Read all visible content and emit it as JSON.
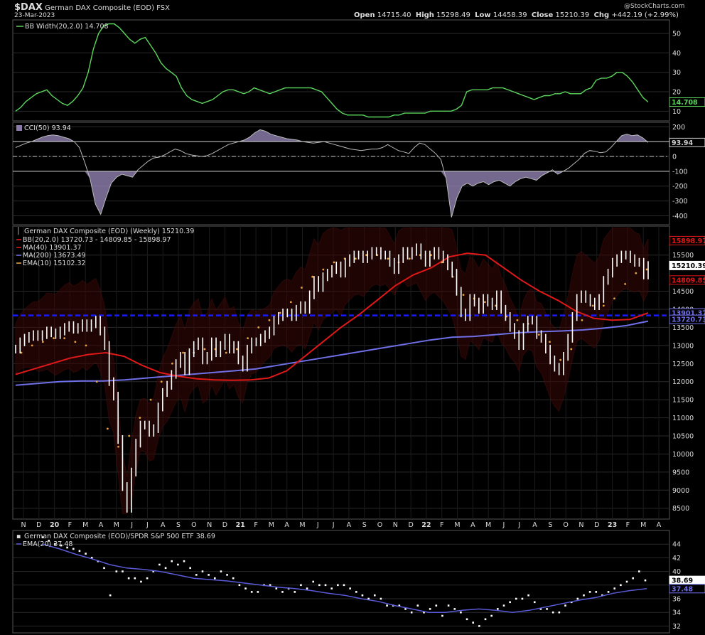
{
  "header": {
    "symbol": "$DAX",
    "name": "German DAX Composite (EOD)",
    "exchange": "FSX",
    "date": "23-Mar-2023",
    "watermark": "@StockCharts.com",
    "ohlc": {
      "open_label": "Open",
      "open": "14715.40",
      "high_label": "High",
      "high": "15298.49",
      "low_label": "Low",
      "low": "14458.39",
      "close_label": "Close",
      "close": "15210.39",
      "chg_label": "Chg",
      "chg": "+442.19 (+2.99%)"
    }
  },
  "colors": {
    "background": "#000000",
    "grid": "#2a2a2a",
    "bbwidth": "#5cd65c",
    "cci_fill": "#8a7aa8",
    "cci_line": "#bbbbbb",
    "price": "#ffffff",
    "ma40": "#e01818",
    "ma200": "#6f6fe8",
    "ema10": "#e8a040",
    "bb_fill": "#3a0808",
    "support": "#1a1aff",
    "ratio": "#ffffff",
    "ratio_ema": "#5a5ad8"
  },
  "chart_data": [
    {
      "type": "line",
      "panel": "bb_width",
      "legend": "BB Width(20,2.0) 14.708",
      "last_value": "14.708",
      "ylim": [
        5,
        57
      ],
      "yticks": [
        "50",
        "40",
        "30",
        "20",
        "10"
      ],
      "ytick_values": [
        50,
        40,
        30,
        20,
        10
      ],
      "series": [
        {
          "name": "BB Width(20,2.0)",
          "values": [
            10,
            12,
            15,
            17,
            19,
            20,
            21,
            18,
            16,
            14,
            13,
            15,
            18,
            22,
            30,
            42,
            50,
            54,
            55,
            55,
            53,
            50,
            47,
            45,
            47,
            48,
            44,
            40,
            35,
            32,
            30,
            28,
            22,
            18,
            16,
            15,
            14,
            15,
            16,
            18,
            20,
            21,
            21,
            20,
            19,
            20,
            22,
            21,
            20,
            19,
            20,
            21,
            22,
            22,
            22,
            22,
            22,
            22,
            21,
            20,
            17,
            14,
            11,
            9,
            8,
            8,
            8,
            8,
            7,
            7,
            7,
            7,
            7,
            8,
            8,
            9,
            9,
            9,
            9,
            9,
            10,
            10,
            10,
            10,
            10,
            11,
            13,
            20,
            21,
            21,
            21,
            21,
            22,
            22,
            22,
            21,
            20,
            19,
            18,
            17,
            16,
            17,
            18,
            18,
            19,
            19,
            20,
            19,
            19,
            19,
            21,
            22,
            26,
            27,
            27,
            28,
            30,
            30,
            28,
            25,
            21,
            17,
            14.708
          ]
        }
      ]
    },
    {
      "type": "area",
      "panel": "cci",
      "legend": "CCI(50) 93.94",
      "last_value": "93.94",
      "ylim": [
        -460,
        230
      ],
      "yticks": [
        "200",
        "100",
        "0",
        "-100",
        "-200",
        "-300",
        "-400"
      ],
      "ytick_values": [
        200,
        100,
        0,
        -100,
        -200,
        -300,
        -400
      ],
      "reference_lines": [
        100,
        0,
        -100
      ],
      "series": [
        {
          "name": "CCI(50)",
          "values": [
            60,
            75,
            90,
            100,
            115,
            130,
            140,
            145,
            140,
            130,
            120,
            100,
            60,
            -40,
            -150,
            -320,
            -390,
            -280,
            -180,
            -140,
            -120,
            -130,
            -140,
            -90,
            -60,
            -30,
            -10,
            -5,
            10,
            30,
            50,
            40,
            20,
            10,
            5,
            0,
            5,
            20,
            40,
            60,
            80,
            90,
            100,
            110,
            130,
            160,
            180,
            170,
            150,
            140,
            130,
            120,
            115,
            110,
            100,
            95,
            90,
            95,
            100,
            90,
            80,
            70,
            60,
            50,
            45,
            40,
            45,
            50,
            50,
            60,
            80,
            60,
            40,
            30,
            20,
            60,
            90,
            80,
            50,
            20,
            -20,
            -150,
            -410,
            -280,
            -200,
            -180,
            -200,
            -180,
            -170,
            -190,
            -170,
            -160,
            -180,
            -200,
            -170,
            -150,
            -140,
            -150,
            -160,
            -130,
            -110,
            -90,
            -120,
            -100,
            -80,
            -50,
            -20,
            20,
            40,
            35,
            25,
            30,
            60,
            100,
            140,
            150,
            140,
            145,
            125,
            93.94
          ]
        }
      ]
    },
    {
      "type": "line",
      "panel": "price",
      "legend": "German DAX Composite (EOD) (Weekly) 15210.39",
      "legend_items": [
        {
          "label": "BB(20,2.0) 13720.73 - 14809.85 - 15898.97",
          "color": "#e01818"
        },
        {
          "label": "MA(40) 13901.37",
          "color": "#e01818"
        },
        {
          "label": "MA(200) 13673.49",
          "color": "#6f6fe8"
        },
        {
          "label": "EMA(10) 15102.32",
          "color": "#e8a040"
        }
      ],
      "ylim": [
        8200,
        16300
      ],
      "yticks": [
        "15500",
        "14500",
        "14000",
        "13500",
        "13000",
        "12500",
        "12000",
        "11500",
        "11000",
        "10500",
        "10000",
        "9500",
        "9000",
        "8500"
      ],
      "ytick_values": [
        15500,
        14500,
        14000,
        13500,
        13000,
        12500,
        12000,
        11500,
        11000,
        10500,
        10000,
        9500,
        9000,
        8500
      ],
      "value_tags": [
        {
          "value": 15898.97,
          "text": "15898.97",
          "color": "#e01818"
        },
        {
          "value": 15210.39,
          "text": "15210.39",
          "color": "#ffffff"
        },
        {
          "value": 14809.85,
          "text": "14809.85",
          "color": "#e01818"
        },
        {
          "value": 13901.37,
          "text": "13901.37",
          "color": "#6f6fe8"
        },
        {
          "value": 13720.73,
          "text": "13720.73",
          "color": "#6f6fe8"
        }
      ],
      "support_level": 13830,
      "x": [
        "N",
        "D",
        "20",
        "F",
        "M",
        "A",
        "M",
        "J",
        "J",
        "A",
        "S",
        "O",
        "N",
        "D",
        "21",
        "F",
        "M",
        "A",
        "M",
        "J",
        "J",
        "A",
        "S",
        "O",
        "N",
        "D",
        "22",
        "F",
        "M",
        "A",
        "M",
        "J",
        "J",
        "A",
        "S",
        "O",
        "N",
        "D",
        "23",
        "F",
        "M",
        "A"
      ],
      "series": [
        {
          "name": "German DAX Composite (EOD)",
          "values": [
            12900,
            13100,
            13200,
            13250,
            13300,
            13250,
            13300,
            13400,
            13350,
            13300,
            13400,
            13500,
            13550,
            13450,
            13500,
            13600,
            13500,
            13600,
            13700,
            13400,
            13000,
            12000,
            11600,
            10400,
            9100,
            8500,
            9500,
            10300,
            10800,
            10800,
            10600,
            10700,
            11300,
            11700,
            11900,
            12200,
            12500,
            12700,
            12300,
            12800,
            13000,
            13100,
            12600,
            12700,
            13100,
            12800,
            13000,
            13200,
            12900,
            13000,
            12600,
            12400,
            12900,
            13100,
            13100,
            13200,
            13300,
            13400,
            13700,
            13800,
            13900,
            13900,
            13800,
            14000,
            14100,
            14000,
            14400,
            14800,
            14600,
            14900,
            15000,
            15100,
            15200,
            15000,
            15300,
            15400,
            15500,
            15500,
            15400,
            15500,
            15600,
            15600,
            15500,
            15500,
            15300,
            15100,
            15400,
            15600,
            15500,
            15600,
            15700,
            15500,
            15300,
            15500,
            15600,
            15500,
            15400,
            15200,
            15000,
            14500,
            13900,
            13800,
            14300,
            14200,
            14000,
            14300,
            14200,
            14100,
            14400,
            14000,
            13800,
            13500,
            13300,
            13000,
            13500,
            13700,
            13700,
            13300,
            13200,
            12900,
            12600,
            12400,
            12300,
            12700,
            13200,
            13800,
            14300,
            14400,
            14300,
            14200,
            14100,
            14300,
            14800,
            15000,
            15300,
            15400,
            15500,
            15500,
            15400,
            15300,
            15300,
            14950,
            15210.39
          ]
        },
        {
          "name": "MA(40)",
          "values": [
            12200,
            12350,
            12500,
            12650,
            12750,
            12800,
            12700,
            12450,
            12250,
            12150,
            12080,
            12050,
            12040,
            12050,
            12100,
            12300,
            12700,
            13100,
            13500,
            13850,
            14250,
            14650,
            14950,
            15150,
            15450,
            15550,
            15500,
            15150,
            14800,
            14500,
            14250,
            13950,
            13750,
            13700,
            13720,
            13901.37
          ]
        },
        {
          "name": "MA(200)",
          "values": [
            11900,
            11950,
            12000,
            12020,
            12020,
            12050,
            12100,
            12150,
            12200,
            12250,
            12300,
            12350,
            12450,
            12550,
            12650,
            12750,
            12850,
            12950,
            13050,
            13150,
            13230,
            13250,
            13300,
            13350,
            13380,
            13400,
            13430,
            13480,
            13550,
            13673.49
          ]
        },
        {
          "name": "EMA(10)",
          "values": [
            12800,
            13000,
            13100,
            13200,
            13200,
            13100,
            13000,
            12000,
            10700,
            10200,
            10500,
            11000,
            11500,
            12000,
            12500,
            12800,
            12800,
            12900,
            12900,
            12800,
            12900,
            13200,
            13500,
            13700,
            13900,
            14200,
            14600,
            14900,
            15100,
            15300,
            15400,
            15400,
            15500,
            15500,
            15400,
            15300,
            15400,
            15500,
            15500,
            15300,
            14900,
            14400,
            14300,
            14200,
            14100,
            13800,
            13700,
            13600,
            13300,
            13100,
            12600,
            12900,
            13700,
            14100,
            14100,
            14300,
            14700,
            15000,
            15102.32
          ]
        }
      ]
    },
    {
      "type": "scatter",
      "panel": "ratio",
      "legend": "German DAX Composite (EOD)/SPDR S&P 500 ETF 38.69",
      "legend_ema": "EMA(20) 37.48",
      "ylim": [
        31,
        46
      ],
      "yticks": [
        "44",
        "42",
        "40",
        "38",
        "36",
        "34",
        "32"
      ],
      "ytick_values": [
        44,
        42,
        40,
        38,
        36,
        34,
        32
      ],
      "value_tags": [
        {
          "value": 38.69,
          "text": "38.69",
          "color": "#ffffff"
        },
        {
          "value": 37.48,
          "text": "37.48",
          "color": "#6f6fe8"
        }
      ],
      "series": [
        {
          "name": "German DAX Composite (EOD)/SPDR S&P 500 ETF",
          "values": [
            45,
            44.5,
            44,
            43.8,
            43.5,
            43.3,
            43,
            42.6,
            42,
            41.5,
            40.5,
            36.5,
            40,
            40,
            39,
            39,
            38.5,
            39,
            40,
            41,
            40.5,
            41.5,
            41,
            41.5,
            40.5,
            39.5,
            40,
            39.5,
            39,
            40,
            39.5,
            39,
            38,
            37.5,
            37,
            37,
            38,
            38,
            37.5,
            37,
            37.5,
            37,
            38,
            37.5,
            38.5,
            38,
            38,
            37.5,
            38,
            38,
            37.5,
            37,
            36.5,
            36,
            36.5,
            36,
            35,
            35,
            35,
            34.5,
            34,
            35,
            34,
            34.5,
            35,
            33.5,
            35,
            34.5,
            34,
            33,
            32.5,
            32,
            33,
            33.5,
            34.5,
            35,
            35.5,
            36,
            36,
            36.5,
            35.5,
            34.5,
            34.5,
            34,
            34,
            35,
            35.5,
            36,
            36.5,
            37,
            37,
            36.5,
            37,
            37.5,
            38,
            38.5,
            39,
            40,
            38.69
          ]
        },
        {
          "name": "EMA(20)",
          "values": [
            44,
            43.3,
            42.5,
            41.8,
            41,
            40.5,
            40.3,
            40,
            39.5,
            39,
            38.8,
            38.6,
            38.3,
            38,
            37.7,
            37.5,
            37.2,
            36.8,
            36.5,
            36,
            35.6,
            35,
            34.5,
            34,
            34,
            34.3,
            34.5,
            34.3,
            34,
            34.3,
            34.8,
            35.3,
            35.8,
            36.2,
            36.8,
            37.2,
            37.48
          ]
        }
      ]
    }
  ]
}
